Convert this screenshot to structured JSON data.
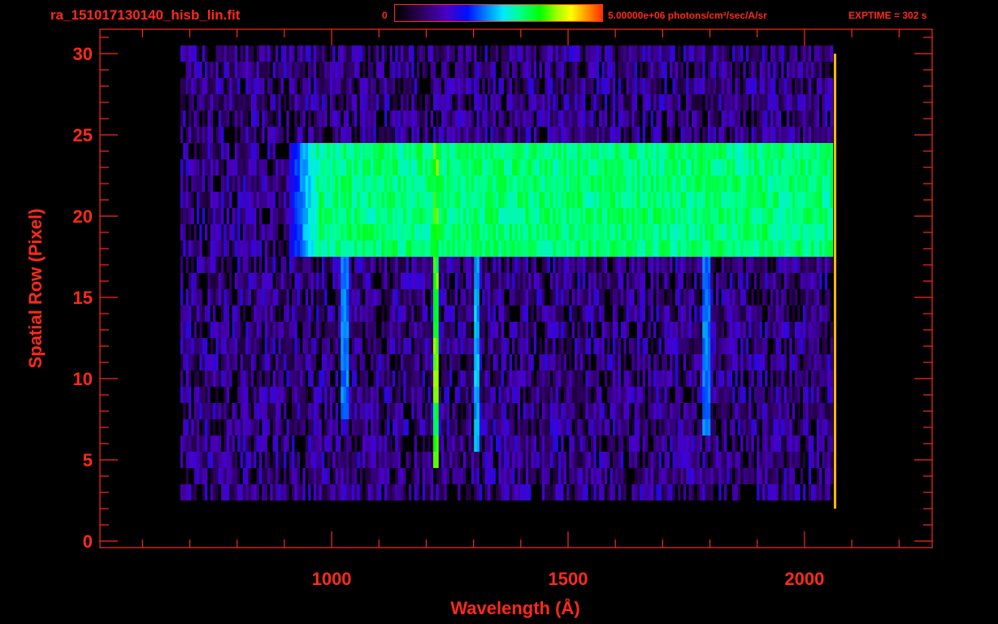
{
  "header": {
    "file_title": "ra_151017130140_hisb_lin.fit",
    "colorbar_min": "0",
    "colorbar_max": "5.00000e+06 photons/cm²/sec/A/sr",
    "exptime": "EXPTIME = 302 s"
  },
  "colors": {
    "text": "#ff2a1a",
    "background": "#000000",
    "colormap": [
      "#000000",
      "#4a00c8",
      "#0010ff",
      "#00e8ff",
      "#00ff00",
      "#ffff00",
      "#ff3000"
    ]
  },
  "chart_data": {
    "type": "heatmap",
    "title": "ra_151017130140_hisb_lin.fit",
    "xlabel": "Wavelength (Å)",
    "ylabel": "Spatial Row (Pixel)",
    "xlim": [
      510,
      2270
    ],
    "ylim": [
      -0.4,
      31.5
    ],
    "xticks": [
      1000,
      1500,
      2000
    ],
    "yticks": [
      0,
      5,
      10,
      15,
      20,
      25,
      30
    ],
    "colorbar_range": [
      0,
      5000000
    ],
    "colorbar_unit": "photons/cm²/sec/A/sr",
    "exptime_s": 302,
    "features": [
      {
        "kind": "bright_band",
        "rows": [
          18,
          24
        ],
        "wavelength": [
          910,
          2060
        ],
        "level": 0.65
      },
      {
        "kind": "emission_line",
        "wavelength": 1216,
        "rows": [
          5,
          24
        ],
        "level": 0.75
      },
      {
        "kind": "emission_line",
        "wavelength": 1304,
        "rows": [
          6,
          18
        ],
        "level": 0.5
      },
      {
        "kind": "emission_line",
        "wavelength": 1026,
        "rows": [
          8,
          18
        ],
        "level": 0.45
      },
      {
        "kind": "emission_line",
        "wavelength": 1790,
        "rows": [
          7,
          18
        ],
        "level": 0.45
      },
      {
        "kind": "noise_background",
        "rows": [
          3,
          30
        ],
        "wavelength": [
          680,
          2060
        ],
        "level": 0.25
      },
      {
        "kind": "red_edge",
        "wavelength": 2062,
        "rows": [
          2,
          30
        ],
        "level": 0.9
      }
    ]
  }
}
